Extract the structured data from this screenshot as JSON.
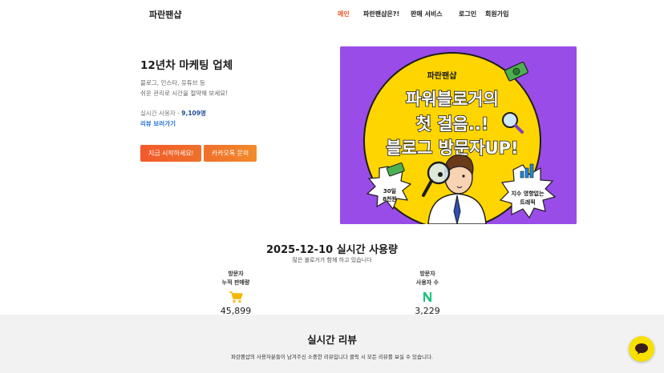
{
  "header": {
    "logo": "파란팬샵",
    "nav": [
      {
        "label": "메인",
        "active": true
      },
      {
        "label": "파란팬샵은?!",
        "active": false
      },
      {
        "label": "판매 서비스",
        "active": false
      },
      {
        "label": "로그인",
        "active": false
      },
      {
        "label": "회원가입",
        "active": false
      }
    ]
  },
  "hero": {
    "title": "12년차 마케팅 업체",
    "desc_line1": "블로그, 인스타, 유튜브 등",
    "desc_line2": "쉬운 관리로 시간을 절약해 보세요!",
    "users_label": "실시간 사용자 - ",
    "users_count": "9,109명",
    "review_link": "리뷰 보러가기",
    "start_button": "지금 시작하세요!",
    "kakao_button": "카카오톡 문의"
  },
  "banner": {
    "brand": "파란팬샵",
    "line1": "파워블로거의",
    "line2": "첫 걸음..!",
    "line3": "블로그 방문자UP!",
    "badge_left_1": "30일",
    "badge_left_2": "8천원",
    "badge_right_1": "지수 영향없는",
    "badge_right_2": "트래픽",
    "colors": {
      "background": "#9a4ce9",
      "circle": "#ffd500",
      "text": "#1d1d1d"
    }
  },
  "stats": {
    "title": "2025-12-10 실시간 사용량",
    "subtitle": "많은 블로거가 함께 하고 있습니다",
    "items": [
      {
        "label1": "방문자",
        "label2": "누적 판매량",
        "icon": "cart-icon",
        "value": "45,899"
      },
      {
        "label1": "방문자",
        "label2": "사용자 수",
        "icon": "naver-n-icon",
        "value": "3,229"
      }
    ]
  },
  "reviews": {
    "title": "실시간 리뷰",
    "subtitle": "파란팬샵의 사용자분들이 남겨주신 소중한 리뷰입니다 클릭 시 모든 리뷰를 보실 수 있습니다."
  },
  "colors": {
    "accent": "#ec5a2c",
    "link": "#1f6fd6",
    "kakao": "#f8e000",
    "cart": "#f5b800",
    "naver": "#19c37d"
  }
}
